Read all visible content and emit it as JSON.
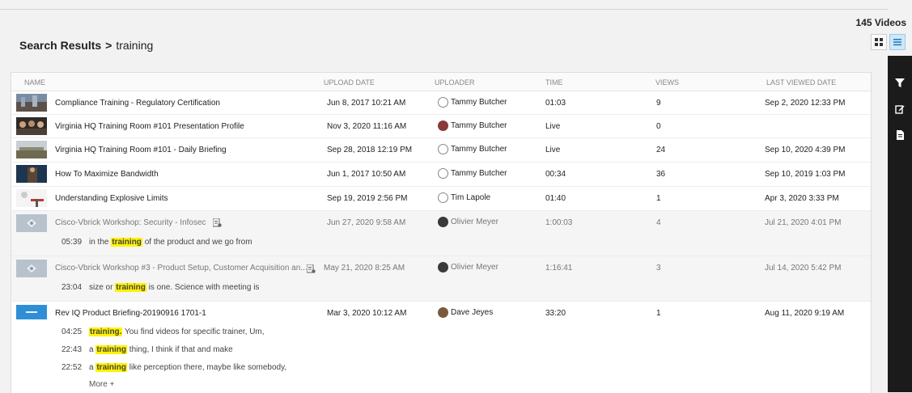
{
  "header": {
    "video_count": "145 Videos",
    "breadcrumb_root": "Search Results",
    "breadcrumb_sep": ">",
    "breadcrumb_term": "training"
  },
  "columns": {
    "name": "NAME",
    "upload_date": "UPLOAD DATE",
    "uploader": "UPLOADER",
    "time": "TIME",
    "views": "VIEWS",
    "last_viewed": "LAST VIEWED DATE"
  },
  "rows": [
    {
      "title": "Compliance Training - Regulatory Certification",
      "upload": "Jun 8, 2017 10:21 AM",
      "uploader": "Tammy Butcher",
      "time": "01:03",
      "views": "9",
      "last": "Sep 2, 2020 12:33 PM"
    },
    {
      "title": "Virginia HQ Training Room #101 Presentation Profile",
      "upload": "Nov 3, 2020 11:16 AM",
      "uploader": "Tammy Butcher",
      "time": "Live",
      "views": "0",
      "last": ""
    },
    {
      "title": "Virginia HQ Training Room #101 - Daily Briefing",
      "upload": "Sep 28, 2018 12:19 PM",
      "uploader": "Tammy Butcher",
      "time": "Live",
      "views": "24",
      "last": "Sep 10, 2020 4:39 PM"
    },
    {
      "title": "How To Maximize Bandwidth",
      "upload": "Jun 1, 2017 10:50 AM",
      "uploader": "Tammy Butcher",
      "time": "00:34",
      "views": "36",
      "last": "Sep 10, 2019 1:03 PM"
    },
    {
      "title": "Understanding Explosive Limits",
      "upload": "Sep 19, 2019 2:56 PM",
      "uploader": "Tim Lapole",
      "time": "01:40",
      "views": "1",
      "last": "Apr 3, 2020 3:33 PM"
    },
    {
      "title": "Cisco-Vbrick Workshop: Security - Infosec",
      "upload": "Jun 27, 2020 9:58 AM",
      "uploader": "Olivier Meyer",
      "time": "1:00:03",
      "views": "4",
      "last": "Jul 21, 2020 4:01 PM",
      "snippets": [
        {
          "ts": "05:39",
          "pre": "in the ",
          "hit": "training",
          "post": " of the product and we go from"
        }
      ]
    },
    {
      "title": "Cisco-Vbrick Workshop #3 - Product Setup, Customer Acquisition an...",
      "upload": "May 21, 2020 8:25 AM",
      "uploader": "Olivier Meyer",
      "time": "1:16:41",
      "views": "3",
      "last": "Jul 14, 2020 5:42 PM",
      "snippets": [
        {
          "ts": "23:04",
          "pre": "size or ",
          "hit": "training",
          "post": " is one. Science with meeting is"
        }
      ]
    },
    {
      "title": "Rev IQ Product Briefing-20190916 1701-1",
      "upload": "Mar 3, 2020 10:12 AM",
      "uploader": "Dave Jeyes",
      "time": "33:20",
      "views": "1",
      "last": "Aug 11, 2020 9:19 AM",
      "snippets": [
        {
          "ts": "04:25",
          "pre": "",
          "hit": "training.",
          "post": " You find videos for specific trainer, Um,"
        },
        {
          "ts": "22:43",
          "pre": "a ",
          "hit": "training",
          "post": " thing, I think if that and make"
        },
        {
          "ts": "22:52",
          "pre": "a ",
          "hit": "training",
          "post": " like perception there, maybe like somebody,"
        }
      ],
      "more": "More +"
    }
  ]
}
